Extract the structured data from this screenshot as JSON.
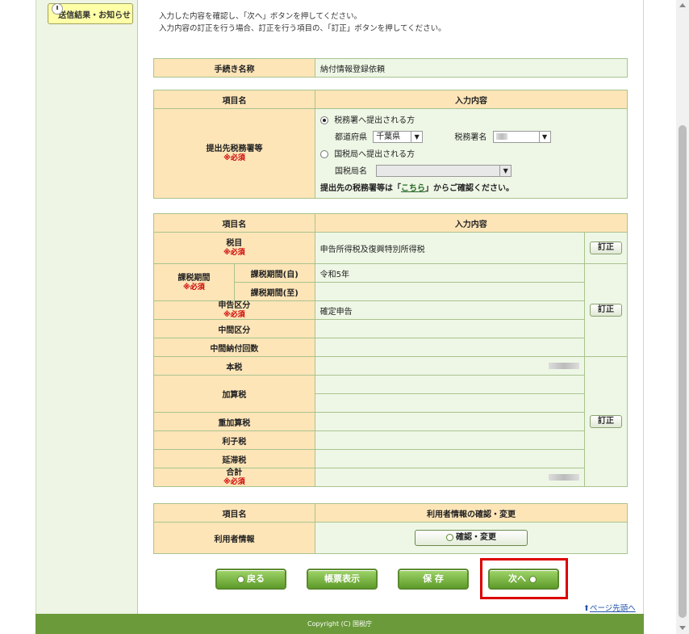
{
  "sidebar": {
    "notice_label": "送信結果・お知らせ"
  },
  "instructions": {
    "line1": "入力した内容を確認し、「次へ」ボタンを押してください。",
    "line2": "入力内容の訂正を行う場合、訂正を行う項目の、「訂正」ボタンを押してください。"
  },
  "procedure": {
    "label": "手続き名称",
    "value": "納付情報登録依頼"
  },
  "office_table": {
    "header_item": "項目名",
    "header_input": "入力内容",
    "row_label": "提出先税務署等",
    "required": "※必須",
    "option_tax_office": "税務署へ提出される方",
    "prefecture_label": "都道府県",
    "prefecture_value": "千葉県",
    "office_label": "税務署名",
    "option_regional_bureau": "国税局へ提出される方",
    "bureau_label": "国税局名",
    "confirm_text_pre": "提出先の税務署等は「",
    "confirm_link": "こちら",
    "confirm_text_post": "」からご確認ください。"
  },
  "detail_table": {
    "header_item": "項目名",
    "header_input": "入力内容",
    "required": "※必須",
    "tax_item_label": "税目",
    "tax_item_value": "申告所得税及復興特別所得税",
    "period_label": "課税期間",
    "period_from_label": "課税期間(自)",
    "period_from_value": "令和5年",
    "period_to_label": "課税期間(至)",
    "filing_type_label": "申告区分",
    "filing_type_value": "確定申告",
    "interim_type_label": "中間区分",
    "interim_count_label": "中間納付回数",
    "principal_label": "本税",
    "additional_label": "加算税",
    "heavy_additional_label": "重加算税",
    "interest_label": "利子税",
    "delinquency_label": "延滞税",
    "total_label": "合計",
    "fix_label": "訂正"
  },
  "user_table": {
    "header_item": "項目名",
    "header_action": "利用者情報の確認・変更",
    "row_label": "利用者情報",
    "button_label": "確認・変更"
  },
  "buttons": {
    "back": "戻る",
    "form_display": "帳票表示",
    "save": "保 存",
    "next": "次へ"
  },
  "page_top_link": "ページ先頭へ",
  "footer": "Copyright (C) 国税庁",
  "colors": {
    "accent_green": "#6a9a3a",
    "label_bg": "#fde5b8",
    "value_bg": "#eef7e6",
    "highlight": "#dd0000"
  }
}
